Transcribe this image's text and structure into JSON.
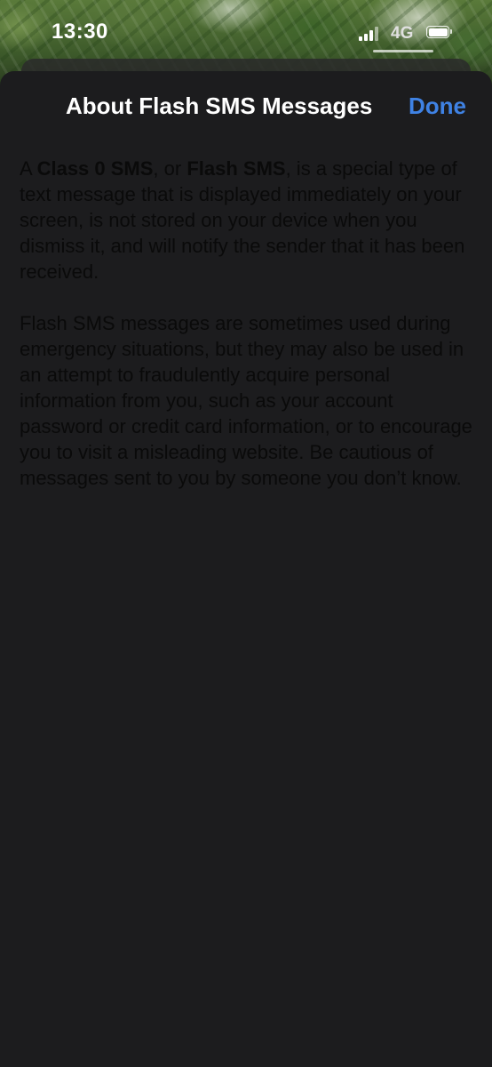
{
  "status_bar": {
    "time": "13:30",
    "network": "4G",
    "battery_level": 1.0
  },
  "sheet": {
    "title": "About Flash SMS Messages",
    "done_label": "Done",
    "accent_color": "#3f82e4",
    "paragraph1": {
      "prefix": "A ",
      "term1": "Class 0 SMS",
      "mid": ", or ",
      "term2": "Flash SMS",
      "suffix": ", is a special type of text message that is displayed immediately on your screen, is not stored on your device when you dismiss it, and will notify the sender that it has been received."
    },
    "paragraph2": "Flash SMS messages are sometimes used during emergency situations, but they may also be used in an attempt to fraudulently acquire personal information from you, such as your account password or credit card information, or to encourage you to visit a misleading website. Be cautious of messages sent to you by someone you don’t know."
  },
  "icons": {
    "signal": "cellular-signal-icon",
    "battery": "battery-icon"
  }
}
